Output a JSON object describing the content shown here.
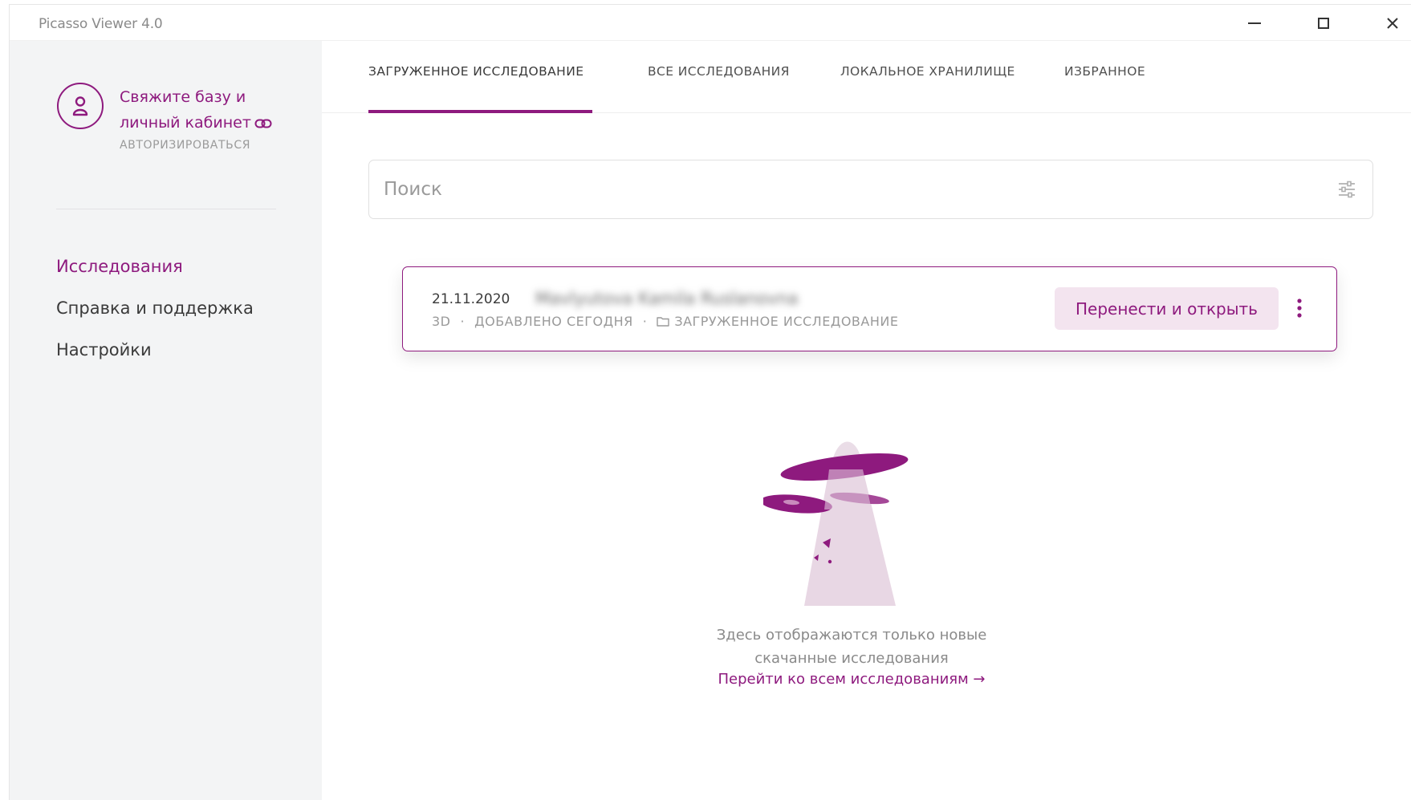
{
  "window": {
    "title": "Picasso Viewer 4.0"
  },
  "sidebar": {
    "auth_title": "Свяжите базу и личный кабинет",
    "auth_action": "АВТОРИЗИРОВАТЬСЯ",
    "nav": [
      {
        "label": "Исследования",
        "active": true
      },
      {
        "label": "Справка и поддержка",
        "active": false
      },
      {
        "label": "Настройки",
        "active": false
      }
    ]
  },
  "tabs": [
    {
      "label": "ЗАГРУЖЕННОЕ ИССЛЕДОВАНИЕ",
      "active": true
    },
    {
      "label": "ВСЕ ИССЛЕДОВАНИЯ",
      "active": false
    },
    {
      "label": "ЛОКАЛЬНОЕ ХРАНИЛИЩЕ",
      "active": false
    },
    {
      "label": "ИЗБРАННОЕ",
      "active": false
    }
  ],
  "search": {
    "placeholder": "Поиск",
    "value": ""
  },
  "study": {
    "date": "21.11.2020",
    "patient_name": "Mavlyutova Kamila Ruslanovna",
    "type": "3D",
    "added": "ДОБАВЛЕНО СЕГОДНЯ",
    "location": "ЗАГРУЖЕННОЕ ИССЛЕДОВАНИЕ",
    "open_button": "Перенести и открыть"
  },
  "empty_state": {
    "line1": "Здесь отображаются только новые",
    "line2": "скачанные исследования",
    "link": "Перейти ко всем исследованиям →"
  },
  "colors": {
    "accent": "#8e1a7e",
    "accent_light": "#f3e4ef",
    "sidebar_bg": "#f3f4f5"
  },
  "icons": [
    "minimize-icon",
    "maximize-icon",
    "close-icon",
    "user-icon",
    "link-icon",
    "filter-icon",
    "folder-icon",
    "more-vertical-icon",
    "ufo-illustration"
  ]
}
